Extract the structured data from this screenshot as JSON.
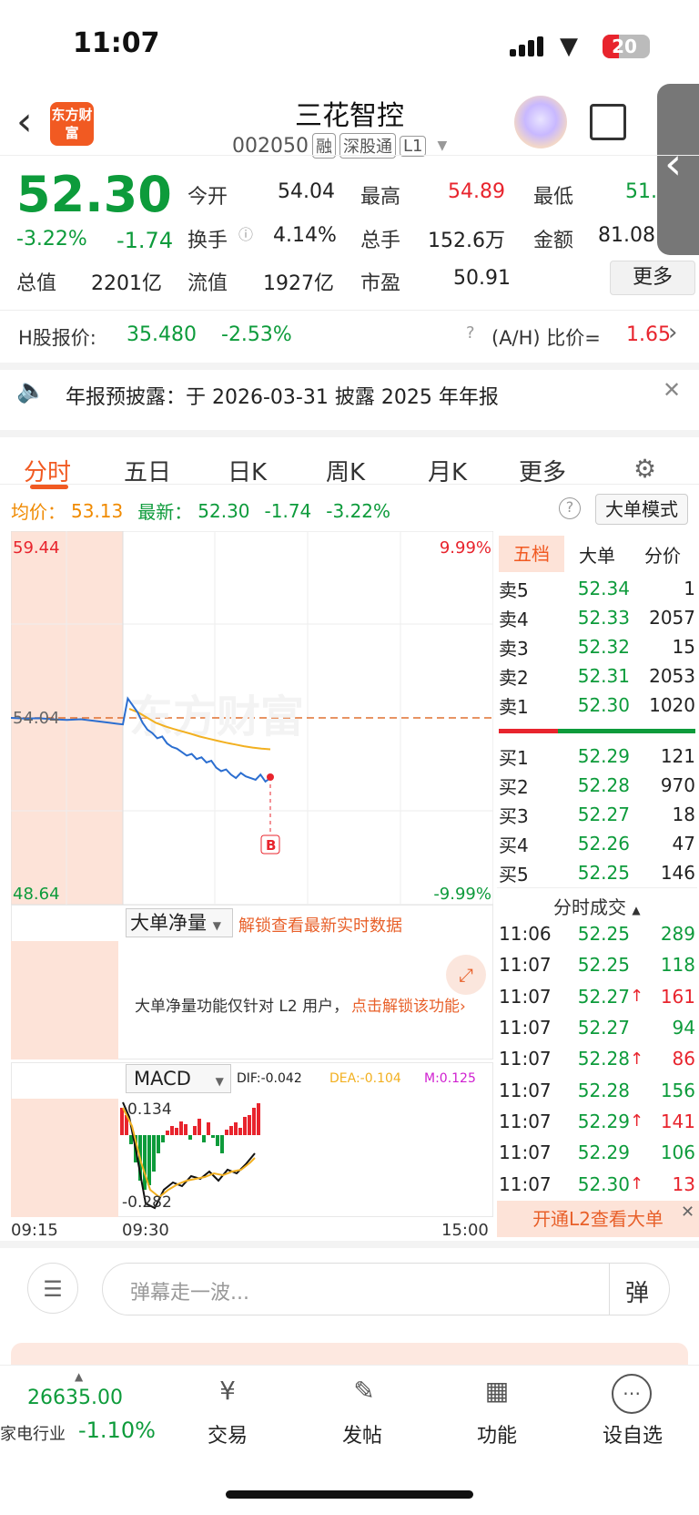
{
  "status": {
    "time": "11:07",
    "battery": "20"
  },
  "header": {
    "title": "三花智控",
    "code": "002050",
    "tags": [
      "融",
      "深股通",
      "L1"
    ],
    "logo": "东方财富"
  },
  "quote": {
    "price": "52.30",
    "pct": "-3.22%",
    "chg": "-1.74",
    "fields": [
      {
        "label": "今开",
        "value": "54.04",
        "color": "#222"
      },
      {
        "label": "最高",
        "value": "54.89",
        "color": "#e8242d"
      },
      {
        "label": "最低",
        "value": "51.",
        "color": "#0d9b3b"
      },
      {
        "label": "换手",
        "value": "4.14%",
        "color": "#222"
      },
      {
        "label": "总手",
        "value": "152.6万",
        "color": "#222"
      },
      {
        "label": "金额",
        "value": "81.08",
        "color": "#222"
      },
      {
        "label": "总值",
        "value": "2201亿",
        "color": "#222"
      },
      {
        "label": "流值",
        "value": "1927亿",
        "color": "#222"
      },
      {
        "label": "市盈",
        "value": "50.91",
        "color": "#222"
      }
    ],
    "more": "更多"
  },
  "hshare": {
    "label": "H股报价:",
    "price": "35.480",
    "pct": "-2.53%",
    "ah_label": "(A/H) 比价=",
    "ah_value": "1.65"
  },
  "notice": {
    "text": "年报预披露：于 2026-03-31 披露 2025 年年报"
  },
  "tabs": [
    "分时",
    "五日",
    "日K",
    "周K",
    "月K",
    "更多"
  ],
  "infoline": {
    "avg_label": "均价：",
    "avg": "53.13",
    "last_label": "最新：",
    "last": "52.30",
    "chg": "-1.74",
    "pct": "-3.22%",
    "mode": "大单模式"
  },
  "chart": {
    "y_top": "59.44",
    "y_mid": "54.04",
    "y_bot": "48.64",
    "pct_top": "9.99%",
    "pct_bot": "-9.99%",
    "watermark": "东方财富",
    "marker": "B",
    "times": [
      "09:15",
      "09:30",
      "15:00"
    ],
    "price_line": [
      54.04,
      54.02,
      54.03,
      54.0,
      53.98,
      54.0,
      53.95,
      53.9,
      53.85,
      54.6,
      54.4,
      54.2,
      53.9,
      53.7,
      53.6,
      53.45,
      53.5,
      53.3,
      53.2,
      53.15,
      53.05,
      52.95,
      53.0,
      52.85,
      52.9,
      52.75,
      52.8,
      52.6,
      52.5,
      52.55,
      52.4,
      52.3,
      52.45,
      52.35,
      52.3,
      52.25,
      52.4,
      52.2,
      52.3
    ],
    "avg_line": [
      54.3,
      54.2,
      54.05,
      53.9,
      53.8,
      53.72,
      53.65,
      53.58,
      53.5,
      53.44,
      53.38,
      53.32,
      53.27,
      53.22,
      53.18,
      53.15,
      53.13
    ]
  },
  "bigorder": {
    "title": "大单净量",
    "unlock": "解锁查看最新实时数据",
    "msg": "大单净量功能仅针对 L2 用户，",
    "link": "点击解锁该功能"
  },
  "macd": {
    "title": "MACD",
    "dif": "DIF:-0.042",
    "dea": "DEA:-0.104",
    "m": "M:0.125",
    "top": "0.134",
    "bot": "-0.282"
  },
  "orderbook": {
    "tabs": [
      "五档",
      "大单",
      "分价"
    ],
    "sells": [
      {
        "label": "卖5",
        "price": "52.34",
        "vol": "1"
      },
      {
        "label": "卖4",
        "price": "52.33",
        "vol": "2057"
      },
      {
        "label": "卖3",
        "price": "52.32",
        "vol": "15"
      },
      {
        "label": "卖2",
        "price": "52.31",
        "vol": "2053"
      },
      {
        "label": "卖1",
        "price": "52.30",
        "vol": "1020"
      }
    ],
    "buys": [
      {
        "label": "买1",
        "price": "52.29",
        "vol": "121"
      },
      {
        "label": "买2",
        "price": "52.28",
        "vol": "970"
      },
      {
        "label": "买3",
        "price": "52.27",
        "vol": "18"
      },
      {
        "label": "买4",
        "price": "52.26",
        "vol": "47"
      },
      {
        "label": "买5",
        "price": "52.25",
        "vol": "146"
      }
    ],
    "ticks_title": "分时成交",
    "ticks": [
      {
        "t": "11:06",
        "p": "52.25",
        "v": "289",
        "up": false,
        "vc": "g"
      },
      {
        "t": "11:07",
        "p": "52.25",
        "v": "118",
        "up": false,
        "vc": "g"
      },
      {
        "t": "11:07",
        "p": "52.27",
        "v": "161",
        "up": true,
        "vc": "r"
      },
      {
        "t": "11:07",
        "p": "52.27",
        "v": "94",
        "up": false,
        "vc": "g"
      },
      {
        "t": "11:07",
        "p": "52.28",
        "v": "86",
        "up": true,
        "vc": "r"
      },
      {
        "t": "11:07",
        "p": "52.28",
        "v": "156",
        "up": false,
        "vc": "g"
      },
      {
        "t": "11:07",
        "p": "52.29",
        "v": "141",
        "up": true,
        "vc": "r"
      },
      {
        "t": "11:07",
        "p": "52.29",
        "v": "106",
        "up": false,
        "vc": "g"
      },
      {
        "t": "11:07",
        "p": "52.30",
        "v": "13",
        "up": true,
        "vc": "r"
      }
    ],
    "l2": "开通L2查看大单"
  },
  "danmu": {
    "placeholder": "弹幕走一波...",
    "btn": "弹"
  },
  "nav": {
    "index_value": "26635.00",
    "index_name": "家电行业",
    "index_pct": "-1.10%",
    "items": [
      "交易",
      "发帖",
      "功能",
      "设自选"
    ]
  }
}
